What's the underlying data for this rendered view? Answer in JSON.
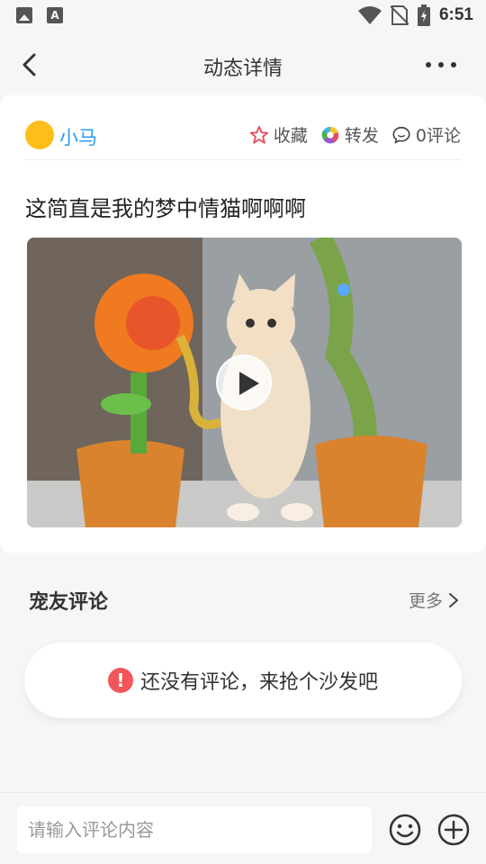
{
  "status_bar": {
    "time": "6:51",
    "left_icons": [
      "image-notification-icon",
      "a-notification-icon"
    ],
    "right_icons": [
      "wifi-icon",
      "no-sim-icon",
      "battery-icon"
    ]
  },
  "nav": {
    "title": "动态详情",
    "back_icon": "chevron-left-icon",
    "more_icon": "more-horizontal-icon"
  },
  "post": {
    "author": "小马",
    "avatar_color": "#ffbd1a",
    "actions": {
      "favorite_label": "收藏",
      "share_label": "转发",
      "comment_label": "0评论"
    },
    "text": "这简直是我的梦中情猫啊啊啊",
    "media": {
      "type": "video",
      "play_icon": "play-icon"
    }
  },
  "comments_section": {
    "title": "宠友评论",
    "more_label": "更多",
    "empty_text": "还没有评论，来抢个沙发吧",
    "empty_icon": "exclamation-icon"
  },
  "bottom_bar": {
    "input_placeholder": "请输入评论内容",
    "emoji_icon": "smiley-icon",
    "plus_icon": "plus-circle-icon"
  },
  "colors": {
    "accent_blue": "#2a9bef",
    "warning_red": "#f2555a",
    "favorite_red": "#e84a5f",
    "background": "#f6f6f7"
  }
}
